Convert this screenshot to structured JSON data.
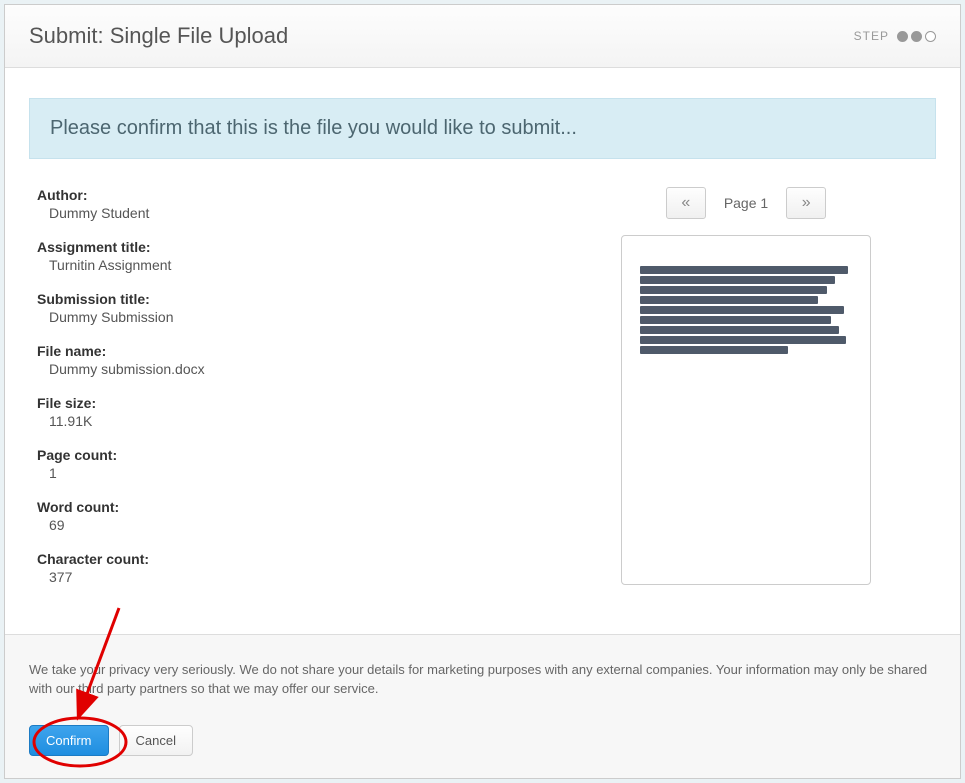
{
  "header": {
    "title": "Submit: Single File Upload",
    "step_label": "STEP"
  },
  "banner": "Please confirm that this is the file you would like to submit...",
  "fields": {
    "author": {
      "label": "Author:",
      "value": "Dummy Student"
    },
    "assignment": {
      "label": "Assignment title:",
      "value": "Turnitin Assignment"
    },
    "submission": {
      "label": "Submission title:",
      "value": "Dummy Submission"
    },
    "filename": {
      "label": "File name:",
      "value": "Dummy submission.docx"
    },
    "filesize": {
      "label": "File size:",
      "value": "11.91K"
    },
    "pagecount": {
      "label": "Page count:",
      "value": "1"
    },
    "wordcount": {
      "label": "Word count:",
      "value": "69"
    },
    "charcount": {
      "label": "Character count:",
      "value": "377"
    }
  },
  "pager": {
    "prev_glyph": "«",
    "next_glyph": "»",
    "label": "Page 1"
  },
  "footer": {
    "privacy": "We take your privacy very seriously. We do not share your details for marketing purposes with any external companies. Your information may only be shared with our third party partners so that we may offer our service.",
    "confirm": "Confirm",
    "cancel": "Cancel"
  }
}
